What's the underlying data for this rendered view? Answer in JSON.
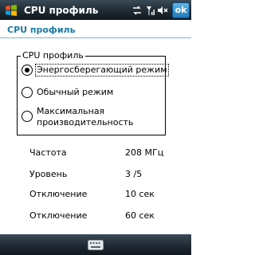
{
  "titlebar": {
    "title": "CPU профиль",
    "ok_label": "ok",
    "icons": [
      "windows-start-icon",
      "connectivity-icon",
      "signal-icon",
      "volume-mute-icon"
    ]
  },
  "section": {
    "title": "CPU профиль"
  },
  "profile_group": {
    "legend": "CPU профиль",
    "options": [
      {
        "label": "Энергосберегающий режим",
        "checked": true
      },
      {
        "label": "Обычный режим",
        "checked": false
      },
      {
        "label": "Максимальная производительность",
        "label_lines": [
          "Максимальная",
          "производительность"
        ],
        "checked": false
      }
    ]
  },
  "info": [
    {
      "label": "Частота",
      "value": "208 МГц"
    },
    {
      "label": "Уровень",
      "value": "3 /5"
    },
    {
      "label": "Отключение",
      "value": "10 сек"
    },
    {
      "label": "Отключение",
      "value": "60 сек"
    }
  ],
  "bottombar": {
    "icon": "keyboard-icon"
  },
  "colors": {
    "accent": "#1a7aa6",
    "bar_dark": "#1f2a33",
    "ok_button": "#1d79b9"
  }
}
